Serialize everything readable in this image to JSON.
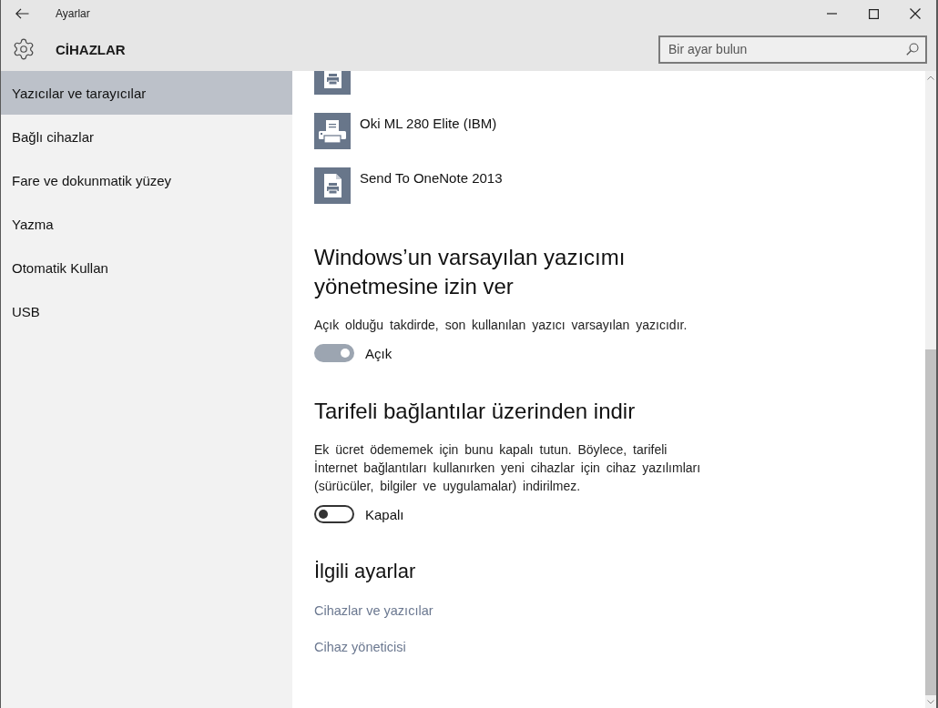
{
  "window": {
    "title": "Ayarlar"
  },
  "header": {
    "title": "CİHAZLAR",
    "search": {
      "placeholder": "Bir ayar bulun"
    }
  },
  "sidebar": {
    "items": [
      {
        "label": "Yazıcılar ve tarayıcılar",
        "selected": true
      },
      {
        "label": "Bağlı cihazlar",
        "selected": false
      },
      {
        "label": "Fare ve dokunmatik yüzey",
        "selected": false
      },
      {
        "label": "Yazma",
        "selected": false
      },
      {
        "label": "Otomatik Kullan",
        "selected": false
      },
      {
        "label": "USB",
        "selected": false
      }
    ]
  },
  "printers": [
    {
      "kind": "document"
    },
    {
      "kind": "printer",
      "name": "Oki ML 280 Elite (IBM)"
    },
    {
      "kind": "document",
      "name": "Send To OneNote 2013"
    }
  ],
  "settings": [
    {
      "heading": "Windows’un varsayılan yazıcımı yönetmesine izin ver",
      "description": "Açık olduğu takdirde, son kullanılan yazıcı varsayılan yazıcıdır.",
      "toggle": {
        "on": true,
        "label": "Açık"
      }
    },
    {
      "heading": "Tarifeli bağlantılar üzerinden indir",
      "description": "Ek ücret ödememek için bunu kapalı tutun. Böylece, tarifeli İnternet bağlantıları kullanırken yeni cihazlar için cihaz yazılımları (sürücüler, bilgiler ve uygulamalar) indirilmez.",
      "toggle": {
        "on": false,
        "label": "Kapalı"
      }
    }
  ],
  "related": {
    "heading": "İlgili ayarlar",
    "links": [
      "Cihazlar ve yazıcılar",
      "Cihaz yöneticisi"
    ]
  }
}
